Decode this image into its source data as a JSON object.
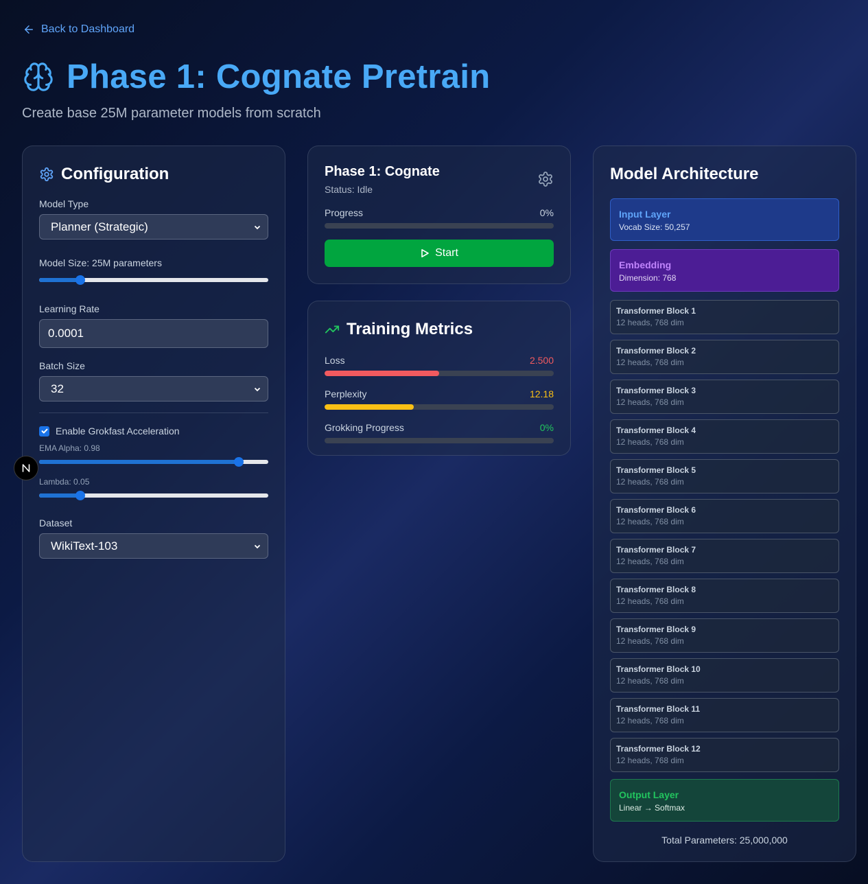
{
  "nav": {
    "back_label": "Back to Dashboard"
  },
  "header": {
    "title": "Phase 1: Cognate Pretrain",
    "subtitle": "Create base 25M parameter models from scratch"
  },
  "config": {
    "title": "Configuration",
    "model_type_label": "Model Type",
    "model_type_value": "Planner (Strategic)",
    "model_size_label": "Model Size: 25M parameters",
    "model_size_fraction": 0.18,
    "learning_rate_label": "Learning Rate",
    "learning_rate_value": "0.0001",
    "batch_size_label": "Batch Size",
    "batch_size_value": "32",
    "grokfast_label": "Enable Grokfast Acceleration",
    "grokfast_checked": true,
    "ema_alpha_label": "EMA Alpha: 0.98",
    "ema_alpha_fraction": 0.87,
    "lambda_label": "Lambda: 0.05",
    "lambda_fraction": 0.18,
    "dataset_label": "Dataset",
    "dataset_value": "WikiText-103"
  },
  "phase": {
    "title": "Phase 1: Cognate",
    "status": "Status: Idle",
    "progress_label": "Progress",
    "progress_value": "0%",
    "progress_fraction": 0,
    "start_label": "Start"
  },
  "metrics": {
    "title": "Training Metrics",
    "loss_label": "Loss",
    "loss_value": "2.500",
    "loss_fraction": 0.5,
    "perplexity_label": "Perplexity",
    "perplexity_value": "12.18",
    "perplexity_fraction": 0.39,
    "grokking_label": "Grokking Progress",
    "grokking_value": "0%",
    "grokking_fraction": 0
  },
  "architecture": {
    "title": "Model Architecture",
    "input": {
      "title": "Input Layer",
      "sub": "Vocab Size: 50,257"
    },
    "embedding": {
      "title": "Embedding",
      "sub": "Dimension: 768"
    },
    "blocks": [
      {
        "title": "Transformer Block 1",
        "sub": "12 heads, 768 dim"
      },
      {
        "title": "Transformer Block 2",
        "sub": "12 heads, 768 dim"
      },
      {
        "title": "Transformer Block 3",
        "sub": "12 heads, 768 dim"
      },
      {
        "title": "Transformer Block 4",
        "sub": "12 heads, 768 dim"
      },
      {
        "title": "Transformer Block 5",
        "sub": "12 heads, 768 dim"
      },
      {
        "title": "Transformer Block 6",
        "sub": "12 heads, 768 dim"
      },
      {
        "title": "Transformer Block 7",
        "sub": "12 heads, 768 dim"
      },
      {
        "title": "Transformer Block 8",
        "sub": "12 heads, 768 dim"
      },
      {
        "title": "Transformer Block 9",
        "sub": "12 heads, 768 dim"
      },
      {
        "title": "Transformer Block 10",
        "sub": "12 heads, 768 dim"
      },
      {
        "title": "Transformer Block 11",
        "sub": "12 heads, 768 dim"
      },
      {
        "title": "Transformer Block 12",
        "sub": "12 heads, 768 dim"
      }
    ],
    "output": {
      "title": "Output Layer",
      "sub": "Linear → Softmax"
    },
    "total": "Total Parameters: 25,000,000"
  },
  "colors": {
    "accent": "#49a9f6",
    "link": "#60a5fa",
    "start": "#01a53f",
    "loss": "#f15a5f",
    "perplexity": "#fac015",
    "grokking": "#22c55e"
  },
  "icons": {
    "back": "arrow-left-icon",
    "title": "brain-icon",
    "config": "gear-icon",
    "phase": "gear-icon",
    "start": "play-icon",
    "metrics": "trending-up-icon",
    "badge": "n-logo-icon"
  },
  "badge": {
    "letter": "N"
  }
}
